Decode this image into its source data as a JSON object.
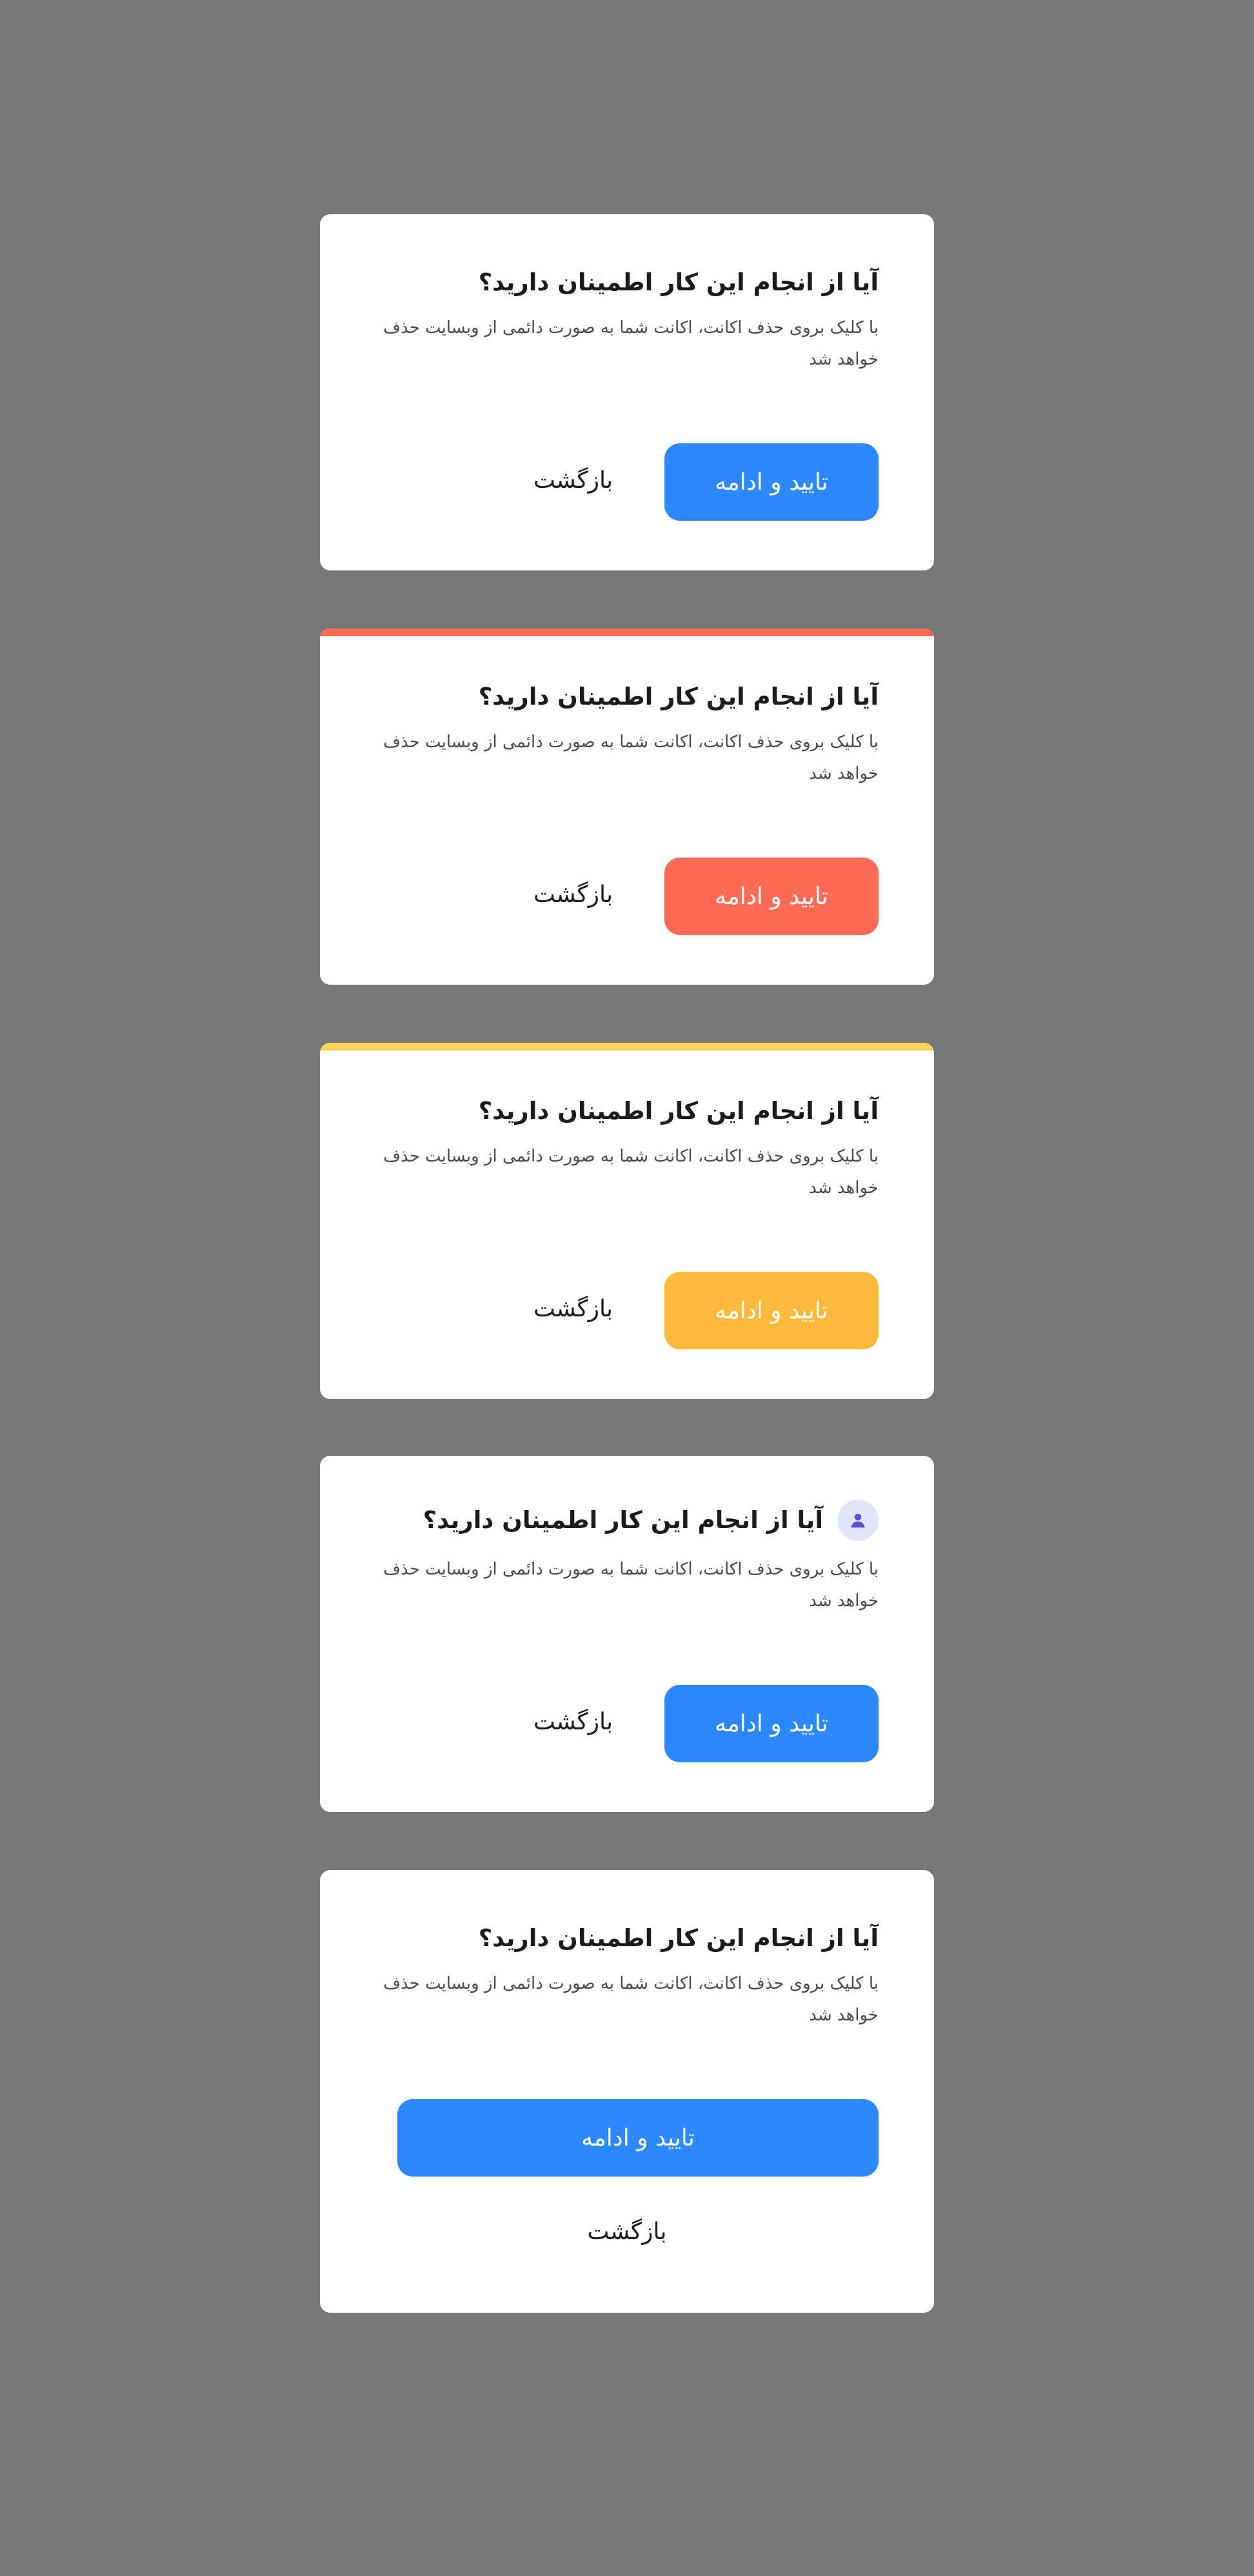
{
  "colors": {
    "page_background": "#777777",
    "card_background": "#ffffff",
    "blue": "#2c88ff",
    "red": "#ff6b57",
    "yellow": "#ffb93b",
    "yellow_bar": "#ffd45e",
    "icon_badge": "#e3e2fb",
    "icon_fill": "#5a4fd3"
  },
  "dialogs": [
    {
      "variant": "default",
      "title": "آیا از انجام این کار اطمینان دارید؟",
      "body": "با کلیک بروی حذف اکانت، اکانت شما به صورت دائمی از وبسایت حذف خواهد شد",
      "confirm_label": "تایید و ادامه",
      "back_label": "بازگشت",
      "accent": "#2c88ff"
    },
    {
      "variant": "danger",
      "title": "آیا از انجام این کار اطمینان دارید؟",
      "body": "با کلیک بروی حذف اکانت، اکانت شما به صورت دائمی از وبسایت حذف خواهد شد",
      "confirm_label": "تایید و ادامه",
      "back_label": "بازگشت",
      "accent": "#ff6b57"
    },
    {
      "variant": "warning",
      "title": "آیا از انجام این کار اطمینان دارید؟",
      "body": "با کلیک بروی حذف اکانت، اکانت شما به صورت دائمی از وبسایت حذف خواهد شد",
      "confirm_label": "تایید و ادامه",
      "back_label": "بازگشت",
      "accent": "#ffb93b"
    },
    {
      "variant": "with-icon",
      "icon": "user-icon",
      "title": "آیا از انجام این کار اطمینان دارید؟",
      "body": "با کلیک بروی حذف اکانت، اکانت شما به صورت دائمی از وبسایت حذف خواهد شد",
      "confirm_label": "تایید و ادامه",
      "back_label": "بازگشت",
      "accent": "#2c88ff"
    },
    {
      "variant": "stacked-buttons",
      "title": "آیا از انجام این کار اطمینان دارید؟",
      "body": "با کلیک بروی حذف اکانت، اکانت شما به صورت دائمی از وبسایت حذف خواهد شد",
      "confirm_label": "تایید و ادامه",
      "back_label": "بازگشت",
      "accent": "#2c88ff"
    }
  ]
}
